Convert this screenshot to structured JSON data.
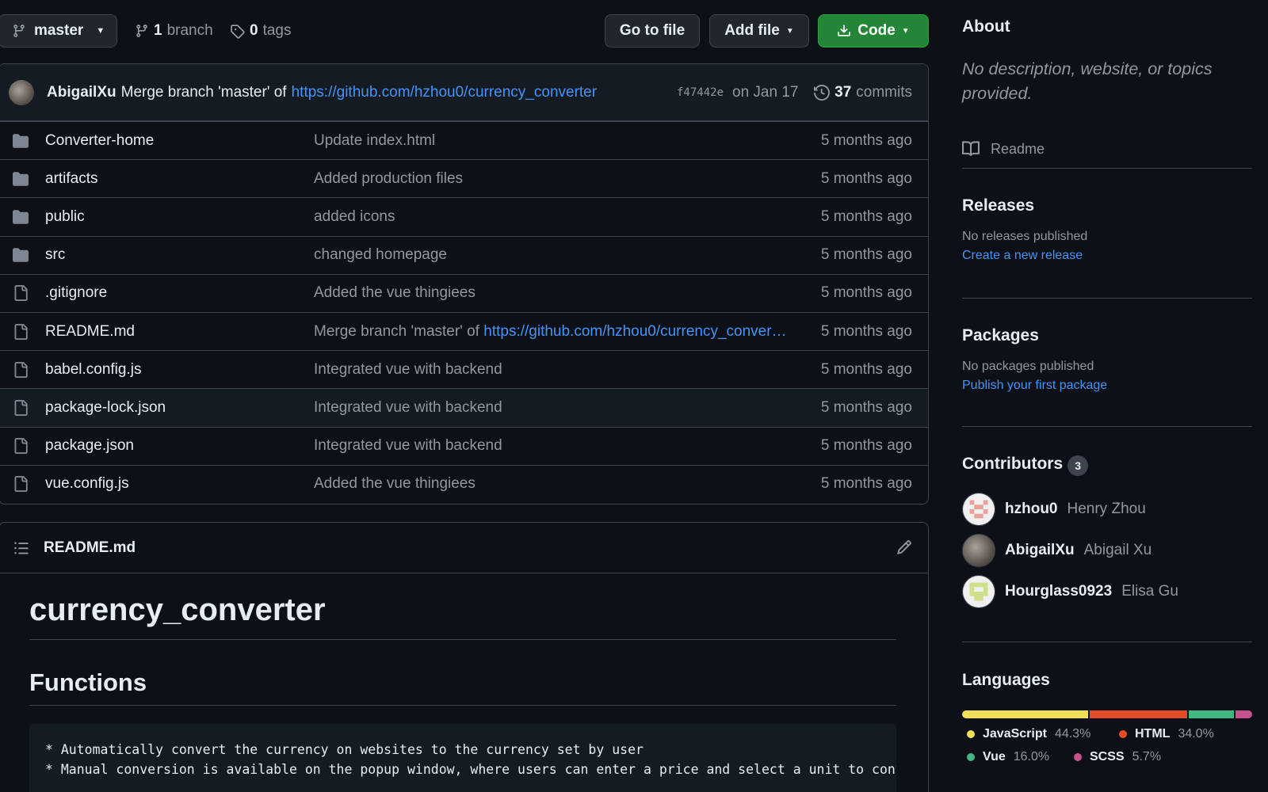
{
  "toolbar": {
    "branch": "master",
    "branches_count": "1",
    "branches_label": "branch",
    "tags_count": "0",
    "tags_label": "tags",
    "go_to_file": "Go to file",
    "add_file": "Add file",
    "code": "Code"
  },
  "commit": {
    "author": "AbigailXu",
    "message_prefix": "Merge branch 'master' of",
    "message_link": "https://github.com/hzhou0/currency_converter",
    "sha": "f47442e",
    "date": "on Jan 17",
    "commits_count": "37",
    "commits_label": "commits"
  },
  "files": [
    {
      "type": "folder",
      "name": "Converter-home",
      "message": "Update index.html",
      "age": "5 months ago"
    },
    {
      "type": "folder",
      "name": "artifacts",
      "message": "Added production files",
      "age": "5 months ago"
    },
    {
      "type": "folder",
      "name": "public",
      "message": "added icons",
      "age": "5 months ago"
    },
    {
      "type": "folder",
      "name": "src",
      "message": "changed homepage",
      "age": "5 months ago"
    },
    {
      "type": "file",
      "name": ".gitignore",
      "message": "Added the vue thingiees",
      "age": "5 months ago"
    },
    {
      "type": "file",
      "name": "README.md",
      "message": "Merge branch 'master' of",
      "message_link": "https://github.com/hzhou0/currency_conver…",
      "age": "5 months ago"
    },
    {
      "type": "file",
      "name": "babel.config.js",
      "message": "Integrated vue with backend",
      "age": "5 months ago"
    },
    {
      "type": "file",
      "name": "package-lock.json",
      "message": "Integrated vue with backend",
      "age": "5 months ago"
    },
    {
      "type": "file",
      "name": "package.json",
      "message": "Integrated vue with backend",
      "age": "5 months ago"
    },
    {
      "type": "file",
      "name": "vue.config.js",
      "message": "Added the vue thingiees",
      "age": "5 months ago"
    }
  ],
  "readme": {
    "filename": "README.md",
    "title": "currency_converter",
    "section": "Functions",
    "code_lines": [
      "* Automatically convert the currency on websites to the currency set by user",
      "* Manual conversion is available on the popup window, where users can enter a price and select a unit to conve"
    ]
  },
  "about": {
    "heading": "About",
    "description": "No description, website, or topics provided.",
    "readme_label": "Readme"
  },
  "releases": {
    "heading": "Releases",
    "text": "No releases published",
    "link": "Create a new release"
  },
  "packages": {
    "heading": "Packages",
    "text": "No packages published",
    "link": "Publish your first package"
  },
  "contributors": {
    "heading": "Contributors",
    "count": "3",
    "people": [
      {
        "login": "hzhou0",
        "name": "Henry Zhou"
      },
      {
        "login": "AbigailXu",
        "name": "Abigail Xu"
      },
      {
        "login": "Hourglass0923",
        "name": "Elisa Gu"
      }
    ]
  },
  "languages": {
    "heading": "Languages",
    "items": [
      {
        "name": "JavaScript",
        "percent": "44.3%",
        "value": 44.3,
        "color": "#f1e05a"
      },
      {
        "name": "HTML",
        "percent": "34.0%",
        "value": 34.0,
        "color": "#e34c26"
      },
      {
        "name": "Vue",
        "percent": "16.0%",
        "value": 16.0,
        "color": "#41b883"
      },
      {
        "name": "SCSS",
        "percent": "5.7%",
        "value": 5.7,
        "color": "#c6538c"
      }
    ]
  }
}
